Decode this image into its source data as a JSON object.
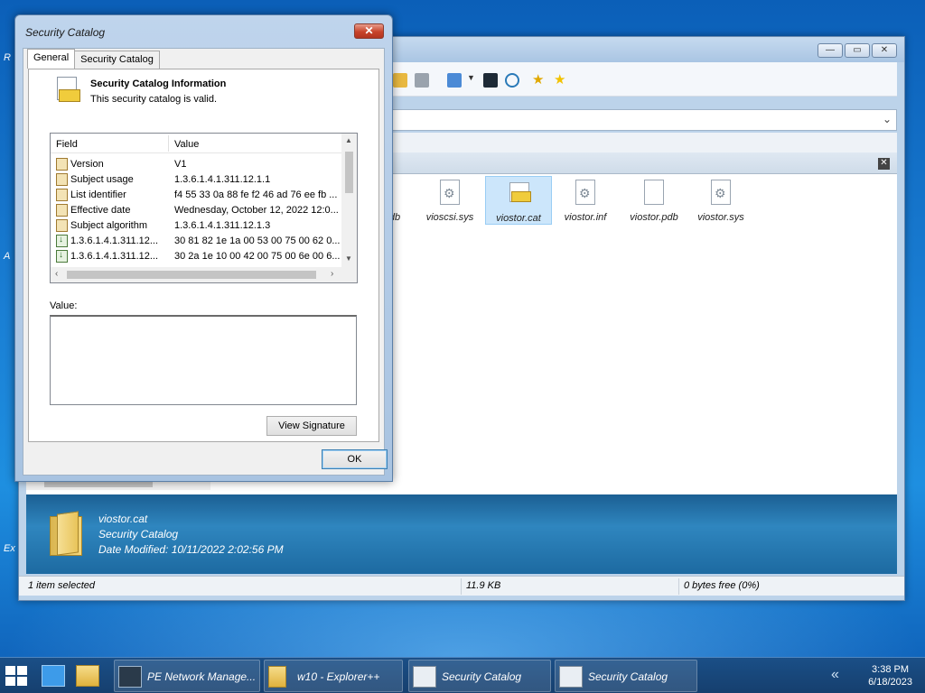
{
  "dialog": {
    "title": "Security Catalog",
    "close_label": "✕",
    "tabs": [
      "General",
      "Security Catalog"
    ],
    "info_title": "Security Catalog Information",
    "info_subtitle": "This security catalog is valid.",
    "columns": [
      "Field",
      "Value"
    ],
    "rows": [
      {
        "field": "Version",
        "value": "V1",
        "icon": "catalog-field-icon"
      },
      {
        "field": "Subject usage",
        "value": "1.3.6.1.4.1.311.12.1.1",
        "icon": "catalog-field-icon"
      },
      {
        "field": "List identifier",
        "value": "f4 55 33 0a 88 fe f2 46 ad 76 ee fb ...",
        "icon": "catalog-field-icon"
      },
      {
        "field": "Effective date",
        "value": "Wednesday, October 12, 2022 12:0...",
        "icon": "catalog-field-icon"
      },
      {
        "field": "Subject algorithm",
        "value": "1.3.6.1.4.1.311.12.1.3",
        "icon": "catalog-field-icon"
      },
      {
        "field": "1.3.6.1.4.1.311.12...",
        "value": "30 81 82 1e 1a 00 53 00 75 00 62 0...",
        "icon": "extension-icon"
      },
      {
        "field": "1.3.6.1.4.1.311.12...",
        "value": "30 2a 1e 10 00 42 00 75 00 6e 00 6...",
        "icon": "extension-icon"
      }
    ],
    "value_label": "Value:",
    "view_signature_label": "View Signature",
    "ok_label": "OK"
  },
  "explorer": {
    "files": [
      {
        "name": "vioscsi.sys",
        "icon": "system-file-icon"
      },
      {
        "name": "viostor.cat",
        "icon": "security-catalog-icon",
        "selected": true
      },
      {
        "name": "viostor.inf",
        "icon": "setup-info-icon"
      },
      {
        "name": "viostor.pdb",
        "icon": "blank-file-icon"
      },
      {
        "name": "viostor.sys",
        "icon": "system-file-icon"
      }
    ],
    "partial_file_label": "db",
    "details": {
      "name": "viostor.cat",
      "type": "Security Catalog",
      "modified": "Date Modified: 10/11/2022 2:02:56 PM"
    },
    "status": {
      "selection": "1 item selected",
      "size": "11.9 KB",
      "free": "0 bytes free (0%)"
    }
  },
  "taskbar": {
    "apps": [
      {
        "label": "PE Network Manage...",
        "icon": "network-manager-icon"
      },
      {
        "label": "w10 - Explorer++",
        "icon": "folder-icon"
      },
      {
        "label": "Security Catalog",
        "icon": "certificate-icon"
      },
      {
        "label": "Security Catalog",
        "icon": "certificate-icon"
      }
    ],
    "time": "3:38 PM",
    "date": "6/18/2023"
  },
  "colors": {
    "accent": "#1a4f87",
    "selection": "#cce6fb",
    "close_red": "#c8432a"
  }
}
